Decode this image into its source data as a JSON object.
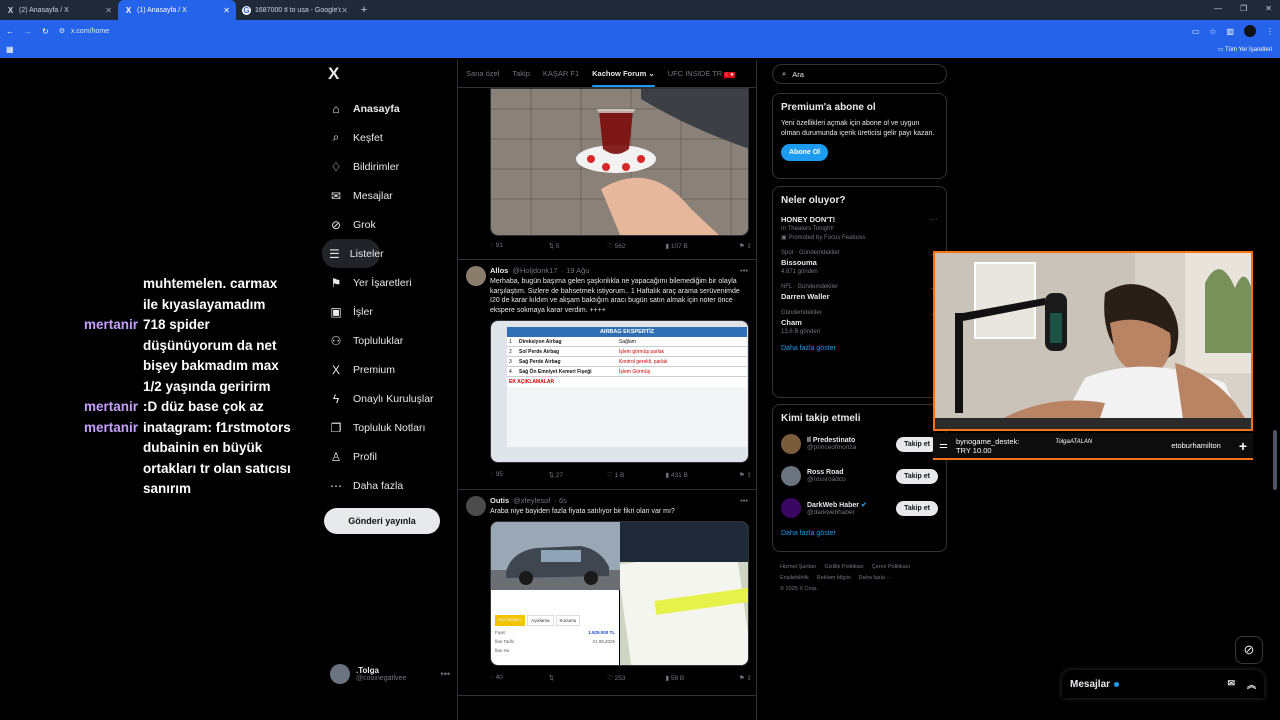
{
  "browser": {
    "tabs": [
      {
        "title": "(2) Anasayfa / X",
        "icon": "x-logo-icon",
        "active": false
      },
      {
        "title": "(1) Anasayfa / X",
        "icon": "x-logo-icon",
        "active": true
      },
      {
        "title": "1687000 tl to usa - Google'da A",
        "icon": "google-icon",
        "active": false
      }
    ],
    "url": "x.com/home",
    "bookmarks_label": "Tüm Yer İşaretleri"
  },
  "chat": [
    {
      "user": "",
      "msg": "muhtemelen. carmax"
    },
    {
      "user": "",
      "msg": "ile kıyaslayamadım"
    },
    {
      "user": "mertanir",
      "msg": "718 spider"
    },
    {
      "user": "",
      "msg": "düşünüyorum da net"
    },
    {
      "user": "",
      "msg": "bişey bakmadım max"
    },
    {
      "user": "",
      "msg": "1/2 yaşında geririrm"
    },
    {
      "user": "mertanir",
      "msg": ":D düz base çok az"
    },
    {
      "user": "mertanir",
      "msg": "inatagram: f1rstmotors"
    },
    {
      "user": "",
      "msg": "dubainin en büyük"
    },
    {
      "user": "",
      "msg": "ortakları tr olan satıcısı"
    },
    {
      "user": "",
      "msg": "sanırım"
    }
  ],
  "nav": {
    "logo": "X",
    "items": [
      {
        "label": "Anasayfa",
        "icon": "⌂"
      },
      {
        "label": "Keşfet",
        "icon": "⌕"
      },
      {
        "label": "Bildirimler",
        "icon": "♢"
      },
      {
        "label": "Mesajlar",
        "icon": "✉"
      },
      {
        "label": "Grok",
        "icon": "⊘"
      },
      {
        "label": "Listeler",
        "icon": "☰"
      },
      {
        "label": "Yer İşaretleri",
        "icon": "⚑"
      },
      {
        "label": "İşler",
        "icon": "▣"
      },
      {
        "label": "Topluluklar",
        "icon": "⚇"
      },
      {
        "label": "Premium",
        "icon": "X"
      },
      {
        "label": "Onaylı Kuruluşlar",
        "icon": "ϟ"
      },
      {
        "label": "Topluluk Notları",
        "icon": "❐"
      },
      {
        "label": "Profil",
        "icon": "♙"
      },
      {
        "label": "Daha fazla",
        "icon": "⋯"
      }
    ],
    "post_label": "Gönderi yayınla",
    "profile_name": ".Tolga",
    "profile_handle": "@cooinegatlvee"
  },
  "feed": {
    "tabs": [
      "Sana özel",
      "Takip",
      "KAŞAR F1",
      "Kachow Forum",
      "UFC INSIDE TR"
    ],
    "posts": [
      {
        "name": "",
        "handle": "",
        "time": "",
        "text": "",
        "actions": {
          "reply": "91",
          "repost": "5",
          "like": "562",
          "views": "107 B"
        }
      },
      {
        "name": "Allos",
        "handle": "@Holjdonk17",
        "time": "· 19 Ağu",
        "text": "Merhaba, bugün başıma gelen şaşkınlıkla ne yapacağımı bilemediğim bir olayla karşılaştım. Sizlere de bahsetmek istiyorum.. 1 Haftalık araç arama serüvenimde I20 de karar kıldım ve akşam baktığım aracı bugün satın almak için noter önce ekspere sokmaya karar verdim. ++++",
        "media_title": "AIRBAG EKSPERTİZ",
        "media_rows": [
          {
            "n": "1",
            "item": "Direksiyon Airbag",
            "status": "Sağlam"
          },
          {
            "n": "2",
            "item": "Sol Perde Airbag",
            "status": "İşlem görmüş parlak"
          },
          {
            "n": "3",
            "item": "Sağ Perde Airbag",
            "status": "Kontrol gerekli, parlak"
          },
          {
            "n": "4",
            "item": "Sağ Ön Emniyet Kemeri Fişeği",
            "status": "İşlem Görmüş"
          }
        ],
        "media_note": "EK AÇIKLAMALAR",
        "actions": {
          "reply": "95",
          "repost": "27",
          "like": "1 B",
          "views": "431 B"
        }
      },
      {
        "name": "Outis",
        "handle": "@xfeylesof",
        "time": "· 6s",
        "text": "Araba niye bayiden fazla fiyata satılıyor bir fikri olan var mı?",
        "media_tabs": [
          "Son Ekipleri",
          "Açıklama",
          "Konumu"
        ],
        "media_price_label": "Fiyat",
        "media_price": "1.925.000 TL",
        "media_date_label": "İlan Tarihi",
        "media_date": "21.08.2025",
        "media_no_label": "İlan No",
        "actions": {
          "reply": "40",
          "repost": "",
          "like": "253",
          "views": "58 B"
        }
      }
    ]
  },
  "right": {
    "search_placeholder": "Ara",
    "premium": {
      "title": "Premium'a abone ol",
      "text": "Yeni özellikleri açmak için abone ol ve uygun olman durumunda içerik üreticisi gelir payı kazan.",
      "button": "Abone Ol"
    },
    "trending": {
      "title": "Neler oluyor?",
      "items": [
        {
          "cat": "",
          "name": "HONEY DON'T!",
          "sub": "In Theaters Tonight!",
          "sub2": "Promoted by Focus Features"
        },
        {
          "cat": "Spor · Gündemdekiler",
          "name": "Bissouma",
          "sub": "4.871 gönderi",
          "sub2": ""
        },
        {
          "cat": "NFL · Gündemdekiler",
          "name": "Darren Waller",
          "sub": "",
          "sub2": ""
        },
        {
          "cat": "Gündemdekiler",
          "name": "Cham",
          "sub": "13,6 B gönderi",
          "sub2": ""
        }
      ],
      "show_more": "Daha fazla göster"
    },
    "who_to_follow": {
      "title": "Kimi takip etmeli",
      "items": [
        {
          "name": "Il Predestinato",
          "handle": "@princeofmonza",
          "button": "Takip et"
        },
        {
          "name": "Ross Road",
          "handle": "@rossroadco",
          "button": "Takip et"
        },
        {
          "name": "DarkWeb Haber",
          "handle": "@darkwebhaber",
          "button": "Takip et"
        }
      ],
      "show_more": "Daha fazla göster"
    },
    "footer": [
      "Hizmet Şartları",
      "Gizlilik Politikası",
      "Çerez Politikası",
      "Erişilebilirlik",
      "Reklam bilgisi",
      "Daha fazla ···",
      "© 2025 X Corp."
    ]
  },
  "stream": {
    "alert_user": "bynogame_destek:",
    "alert_amount": "TRY 10.00",
    "signature": "TolgaATALAN",
    "right_name": "etoburhamilton"
  },
  "messages_drawer": "Mesajlar"
}
